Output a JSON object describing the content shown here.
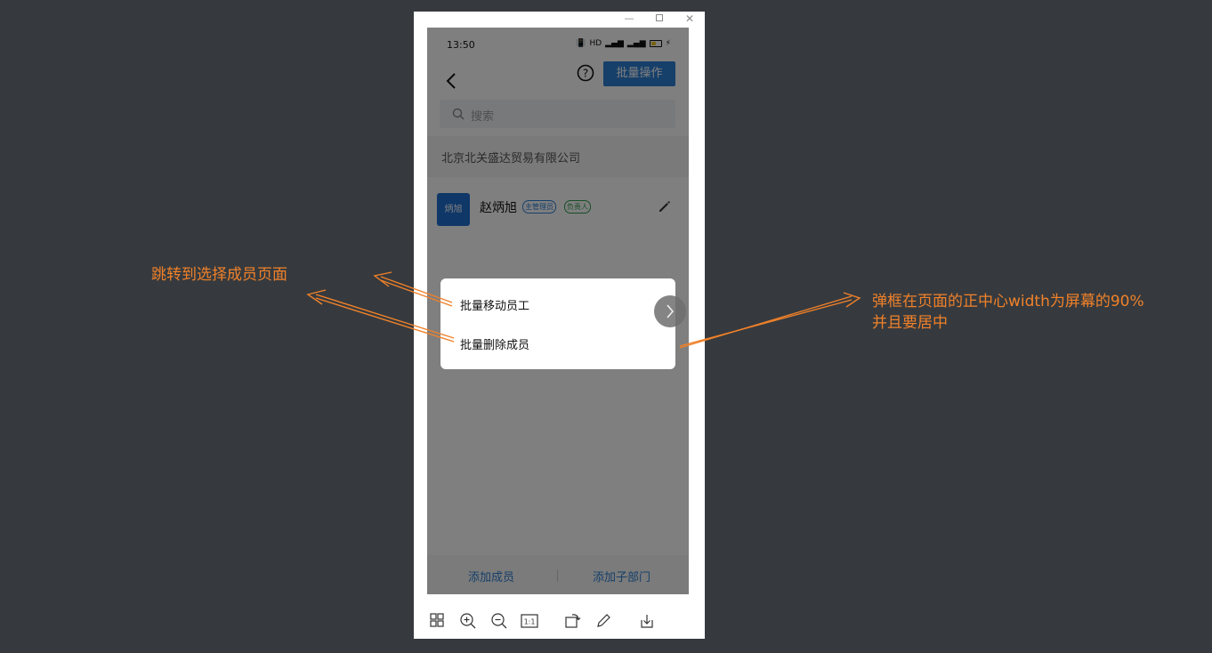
{
  "status_bar": {
    "time": "13:50",
    "network_label": "HD"
  },
  "nav": {
    "batch_button": "批量操作"
  },
  "search": {
    "placeholder": "搜索"
  },
  "company": {
    "name": "北京北关盛达贸易有限公司"
  },
  "member": {
    "avatar_text": "炳旭",
    "name": "赵炳旭",
    "tags": [
      "主管理员",
      "负责人"
    ]
  },
  "popup": {
    "items": [
      "批量移动员工",
      "批量删除成员"
    ]
  },
  "bottom_bar": {
    "add_member": "添加成员",
    "add_department": "添加子部门"
  },
  "annotations": {
    "left": "跳转到选择成员页面",
    "right_line1": "弹框在页面的正中心width为屏幕的90%",
    "right_line2": "并且要居中"
  },
  "colors": {
    "accent": "#2d7fd4",
    "annotation": "#f0812a",
    "background": "#363a3e"
  }
}
